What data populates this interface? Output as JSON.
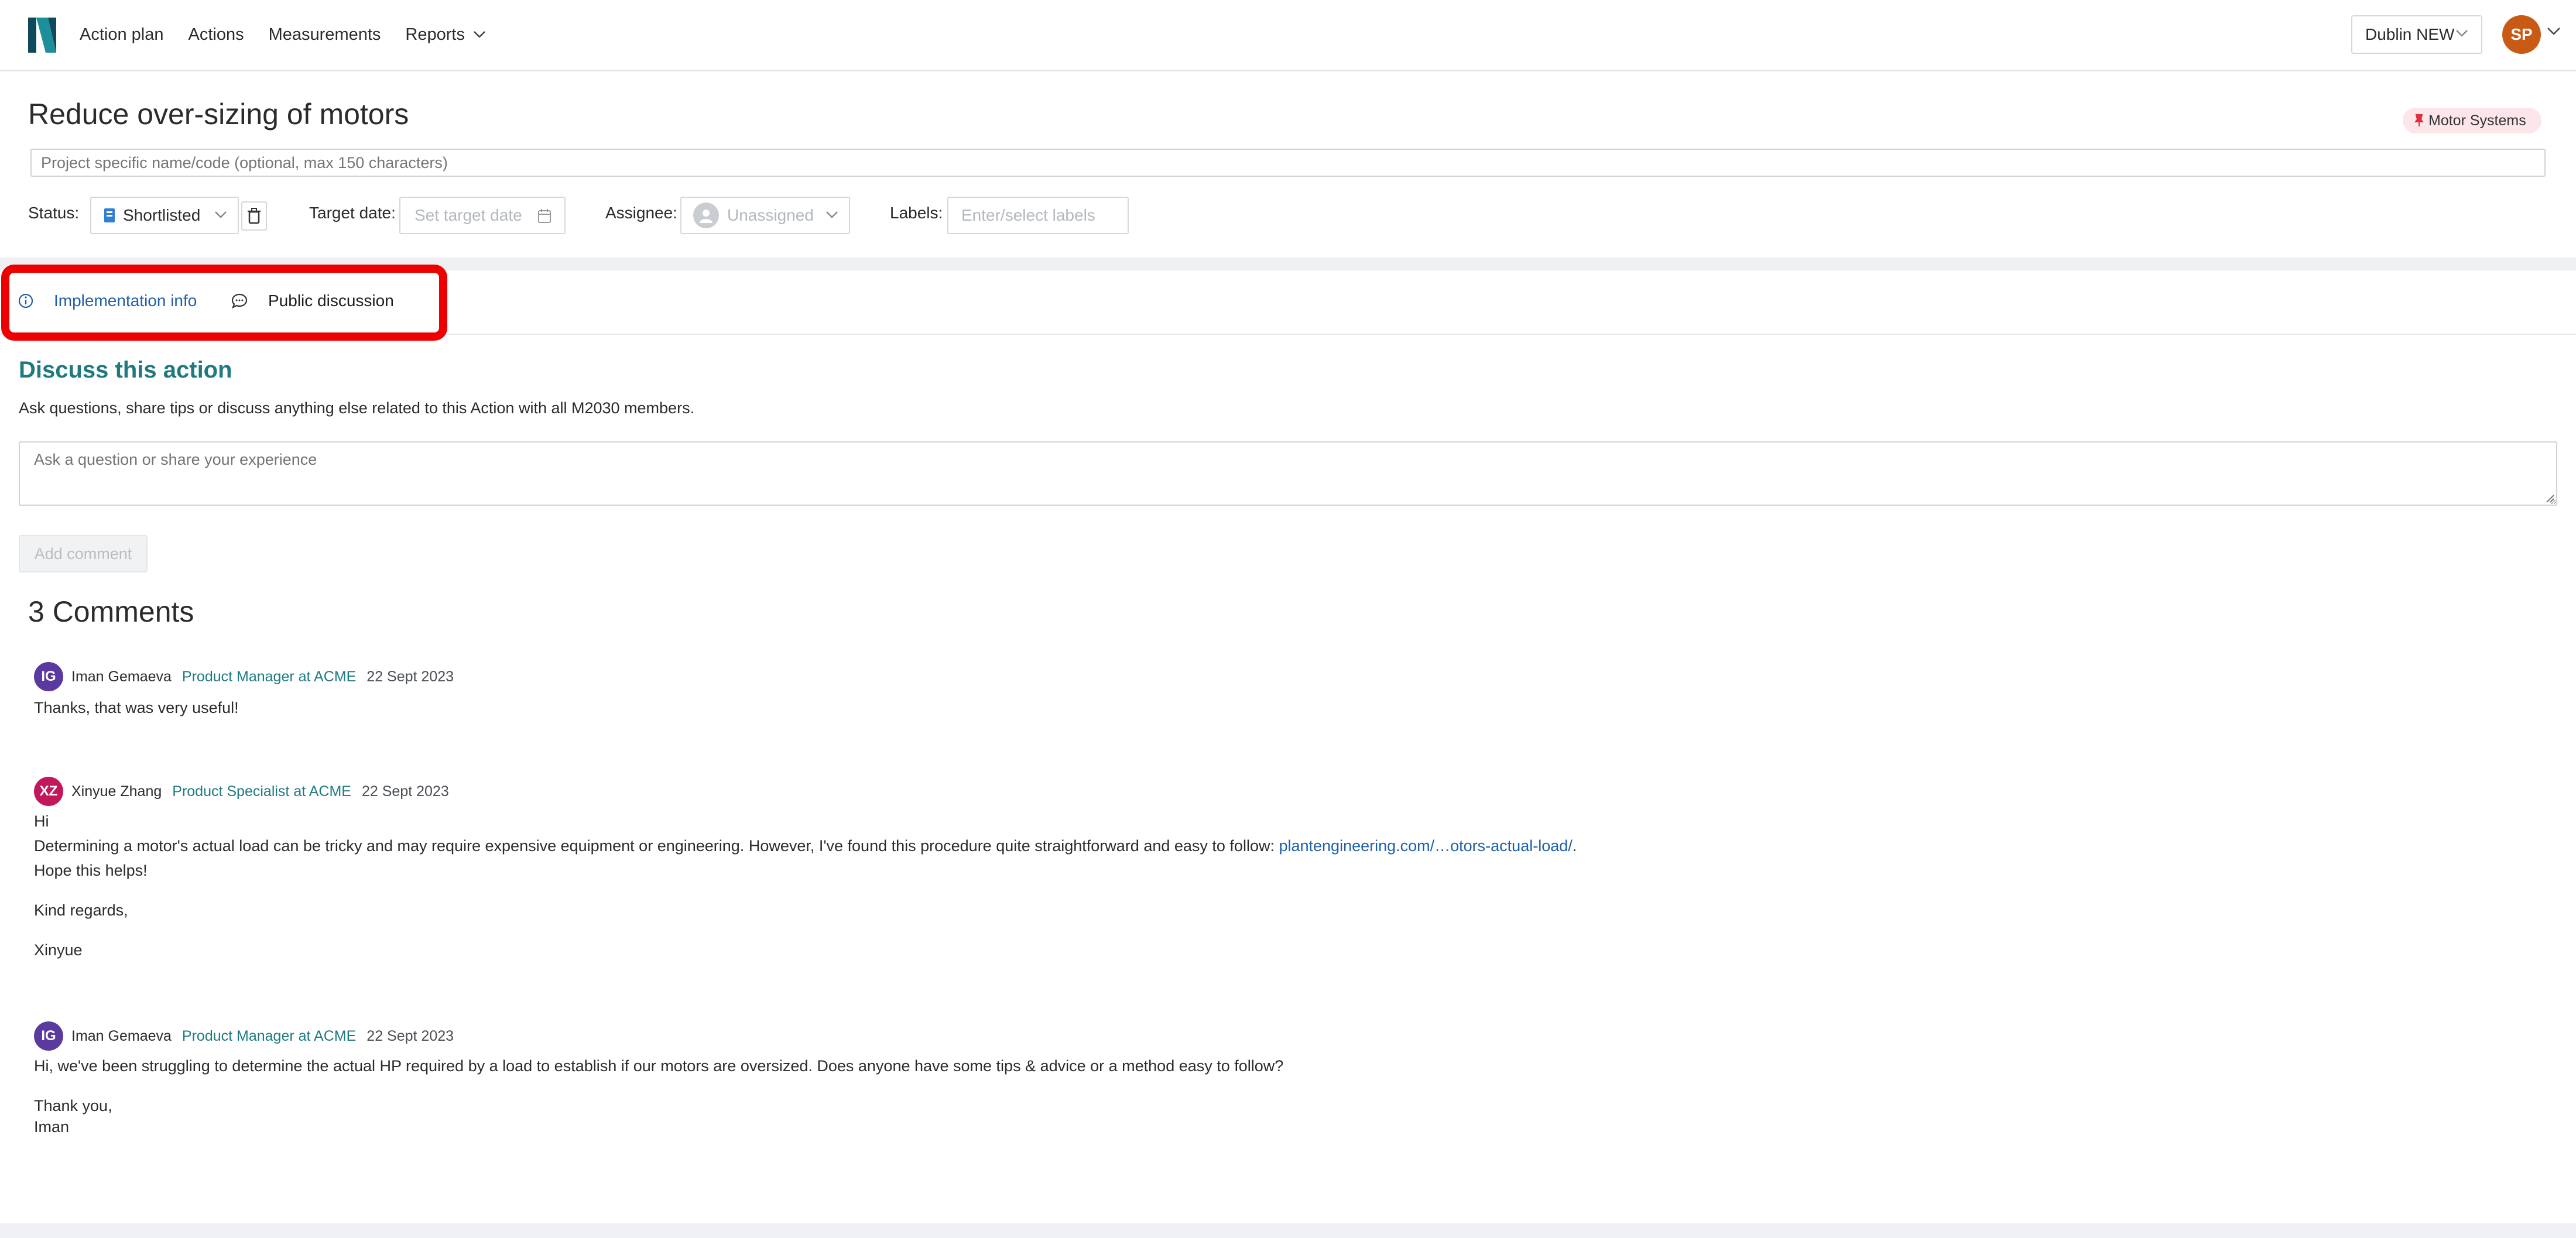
{
  "nav": {
    "links": [
      "Action plan",
      "Actions",
      "Measurements",
      "Reports"
    ],
    "org": "Dublin NEW",
    "user_initials": "SP"
  },
  "header": {
    "title": "Reduce over-sizing of motors",
    "category": "Motor Systems",
    "project_name_placeholder": "Project specific name/code (optional, max 150 characters)",
    "status_label": "Status:",
    "status_value": "Shortlisted",
    "target_date_label": "Target date:",
    "target_date_placeholder": "Set target date",
    "assignee_label": "Assignee:",
    "assignee_value": "Unassigned",
    "labels_label": "Labels:",
    "labels_placeholder": "Enter/select labels"
  },
  "tabs": {
    "implementation": "Implementation info",
    "discussion": "Public discussion"
  },
  "discussion": {
    "title": "Discuss this action",
    "description": "Ask questions, share tips or discuss anything else related to this Action with all M2030 members.",
    "input_placeholder": "Ask a question or share your experience",
    "add_button": "Add comment",
    "count_label": "3 Comments"
  },
  "comments": [
    {
      "initials": "IG",
      "avatar_color": "#5b3aa0",
      "author": "Iman Gemaeva",
      "role": "Product Manager at ACME",
      "date": "22 Sept 2023",
      "line1": "Thanks, that was very useful!"
    },
    {
      "initials": "XZ",
      "avatar_color": "#c2185b",
      "author": "Xinyue Zhang",
      "role": "Product Specialist at ACME",
      "date": "22 Sept 2023",
      "line1": "Hi",
      "line2_text": "Determining a motor's actual load can be tricky and may require expensive equipment or engineering. However, I've found this procedure quite straightforward and easy to follow: ",
      "line2_link": "plantengineering.com/…otors-actual-load/",
      "line2_end": ".",
      "line3": "Hope this helps!",
      "line4": "Kind regards,",
      "line5": "Xinyue"
    },
    {
      "initials": "IG",
      "avatar_color": "#5b3aa0",
      "author": "Iman Gemaeva",
      "role": "Product Manager at ACME",
      "date": "22 Sept 2023",
      "line1": "Hi, we've been struggling to determine the actual HP required by a load to establish if our motors are oversized. Does anyone have some tips & advice or a method easy to follow?",
      "line2": "Thank you,",
      "line3": "Iman"
    }
  ],
  "colors": {
    "accent_teal": "#1f7a80",
    "link_blue": "#1f5fa8",
    "highlight_red": "#ee0000"
  }
}
